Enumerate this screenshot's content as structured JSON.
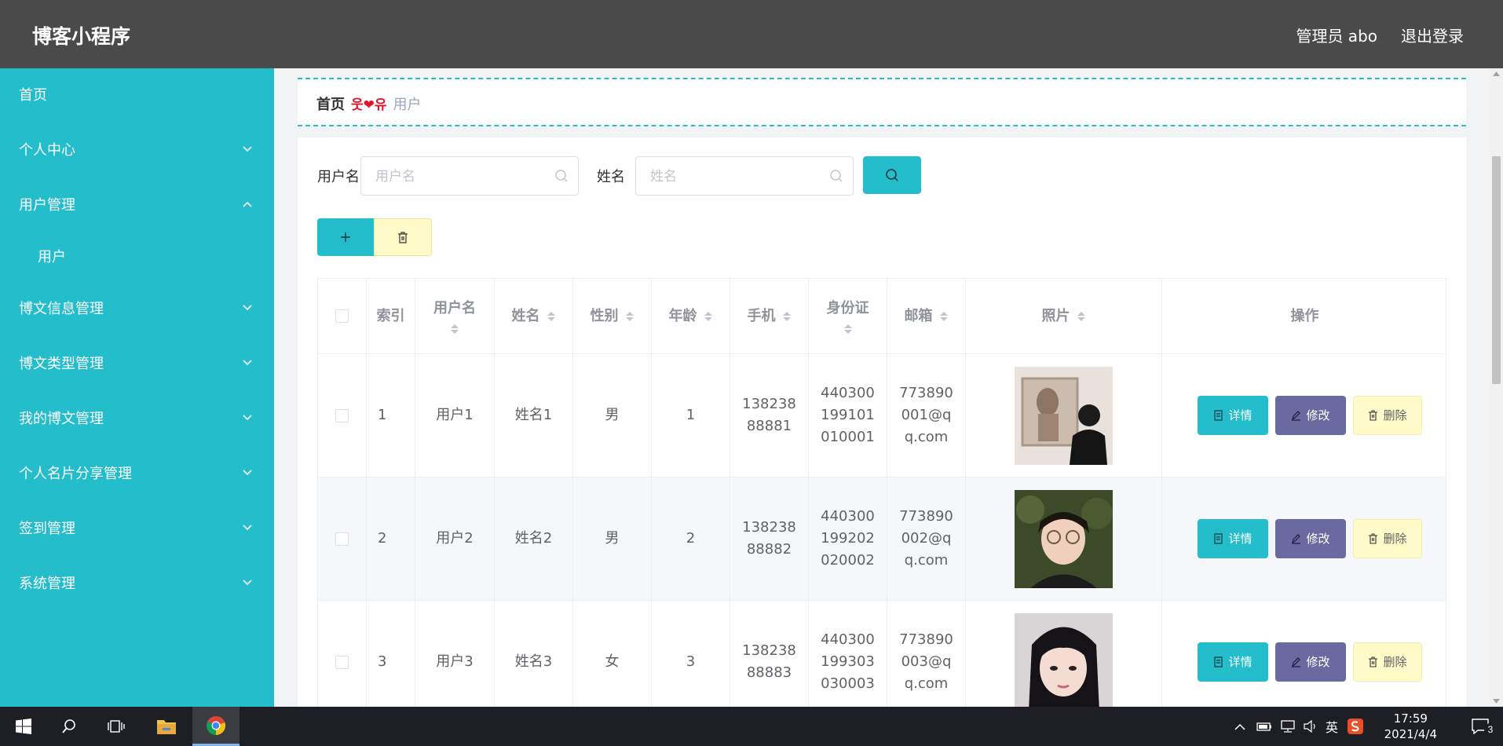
{
  "header": {
    "brand": "博客小程序",
    "admin": "管理员 abo",
    "logout": "退出登录"
  },
  "sidebar": {
    "items": [
      {
        "label": "首页"
      },
      {
        "label": "个人中心"
      },
      {
        "label": "用户管理"
      },
      {
        "label": "用户"
      },
      {
        "label": "博文信息管理"
      },
      {
        "label": "博文类型管理"
      },
      {
        "label": "我的博文管理"
      },
      {
        "label": "个人名片分享管理"
      },
      {
        "label": "签到管理"
      },
      {
        "label": "系统管理"
      }
    ]
  },
  "breadcrumb": {
    "home": "首页",
    "separator": "웃❤유",
    "current": "用户"
  },
  "search": {
    "username_label": "用户名",
    "username_placeholder": "用户名",
    "name_label": "姓名",
    "name_placeholder": "姓名"
  },
  "table": {
    "headers": {
      "index": "索引",
      "username": "用户名",
      "name": "姓名",
      "gender": "性别",
      "age": "年龄",
      "phone": "手机",
      "idcard": "身份证",
      "email": "邮箱",
      "photo": "照片",
      "actions": "操作"
    },
    "rows": [
      {
        "index": "1",
        "username": "用户1",
        "name": "姓名1",
        "gender": "男",
        "age": "1",
        "phone": "13823888881",
        "idcard": "440300199101010001",
        "email": "773890001@qq.com"
      },
      {
        "index": "2",
        "username": "用户2",
        "name": "姓名2",
        "gender": "男",
        "age": "2",
        "phone": "13823888882",
        "idcard": "440300199202020002",
        "email": "773890002@qq.com"
      },
      {
        "index": "3",
        "username": "用户3",
        "name": "姓名3",
        "gender": "女",
        "age": "3",
        "phone": "13823888883",
        "idcard": "440300199303030003",
        "email": "773890003@qq.com"
      }
    ],
    "row_buttons": {
      "detail": "详情",
      "edit": "修改",
      "delete": "删除"
    }
  },
  "taskbar": {
    "time": "17:59",
    "date": "2021/4/4",
    "ime": "英",
    "notifications": "3"
  },
  "colors": {
    "accent": "#23bdcc",
    "header_bg": "#4a4a4a",
    "edit": "#6b6aa0",
    "delete": "#fffbc8"
  }
}
